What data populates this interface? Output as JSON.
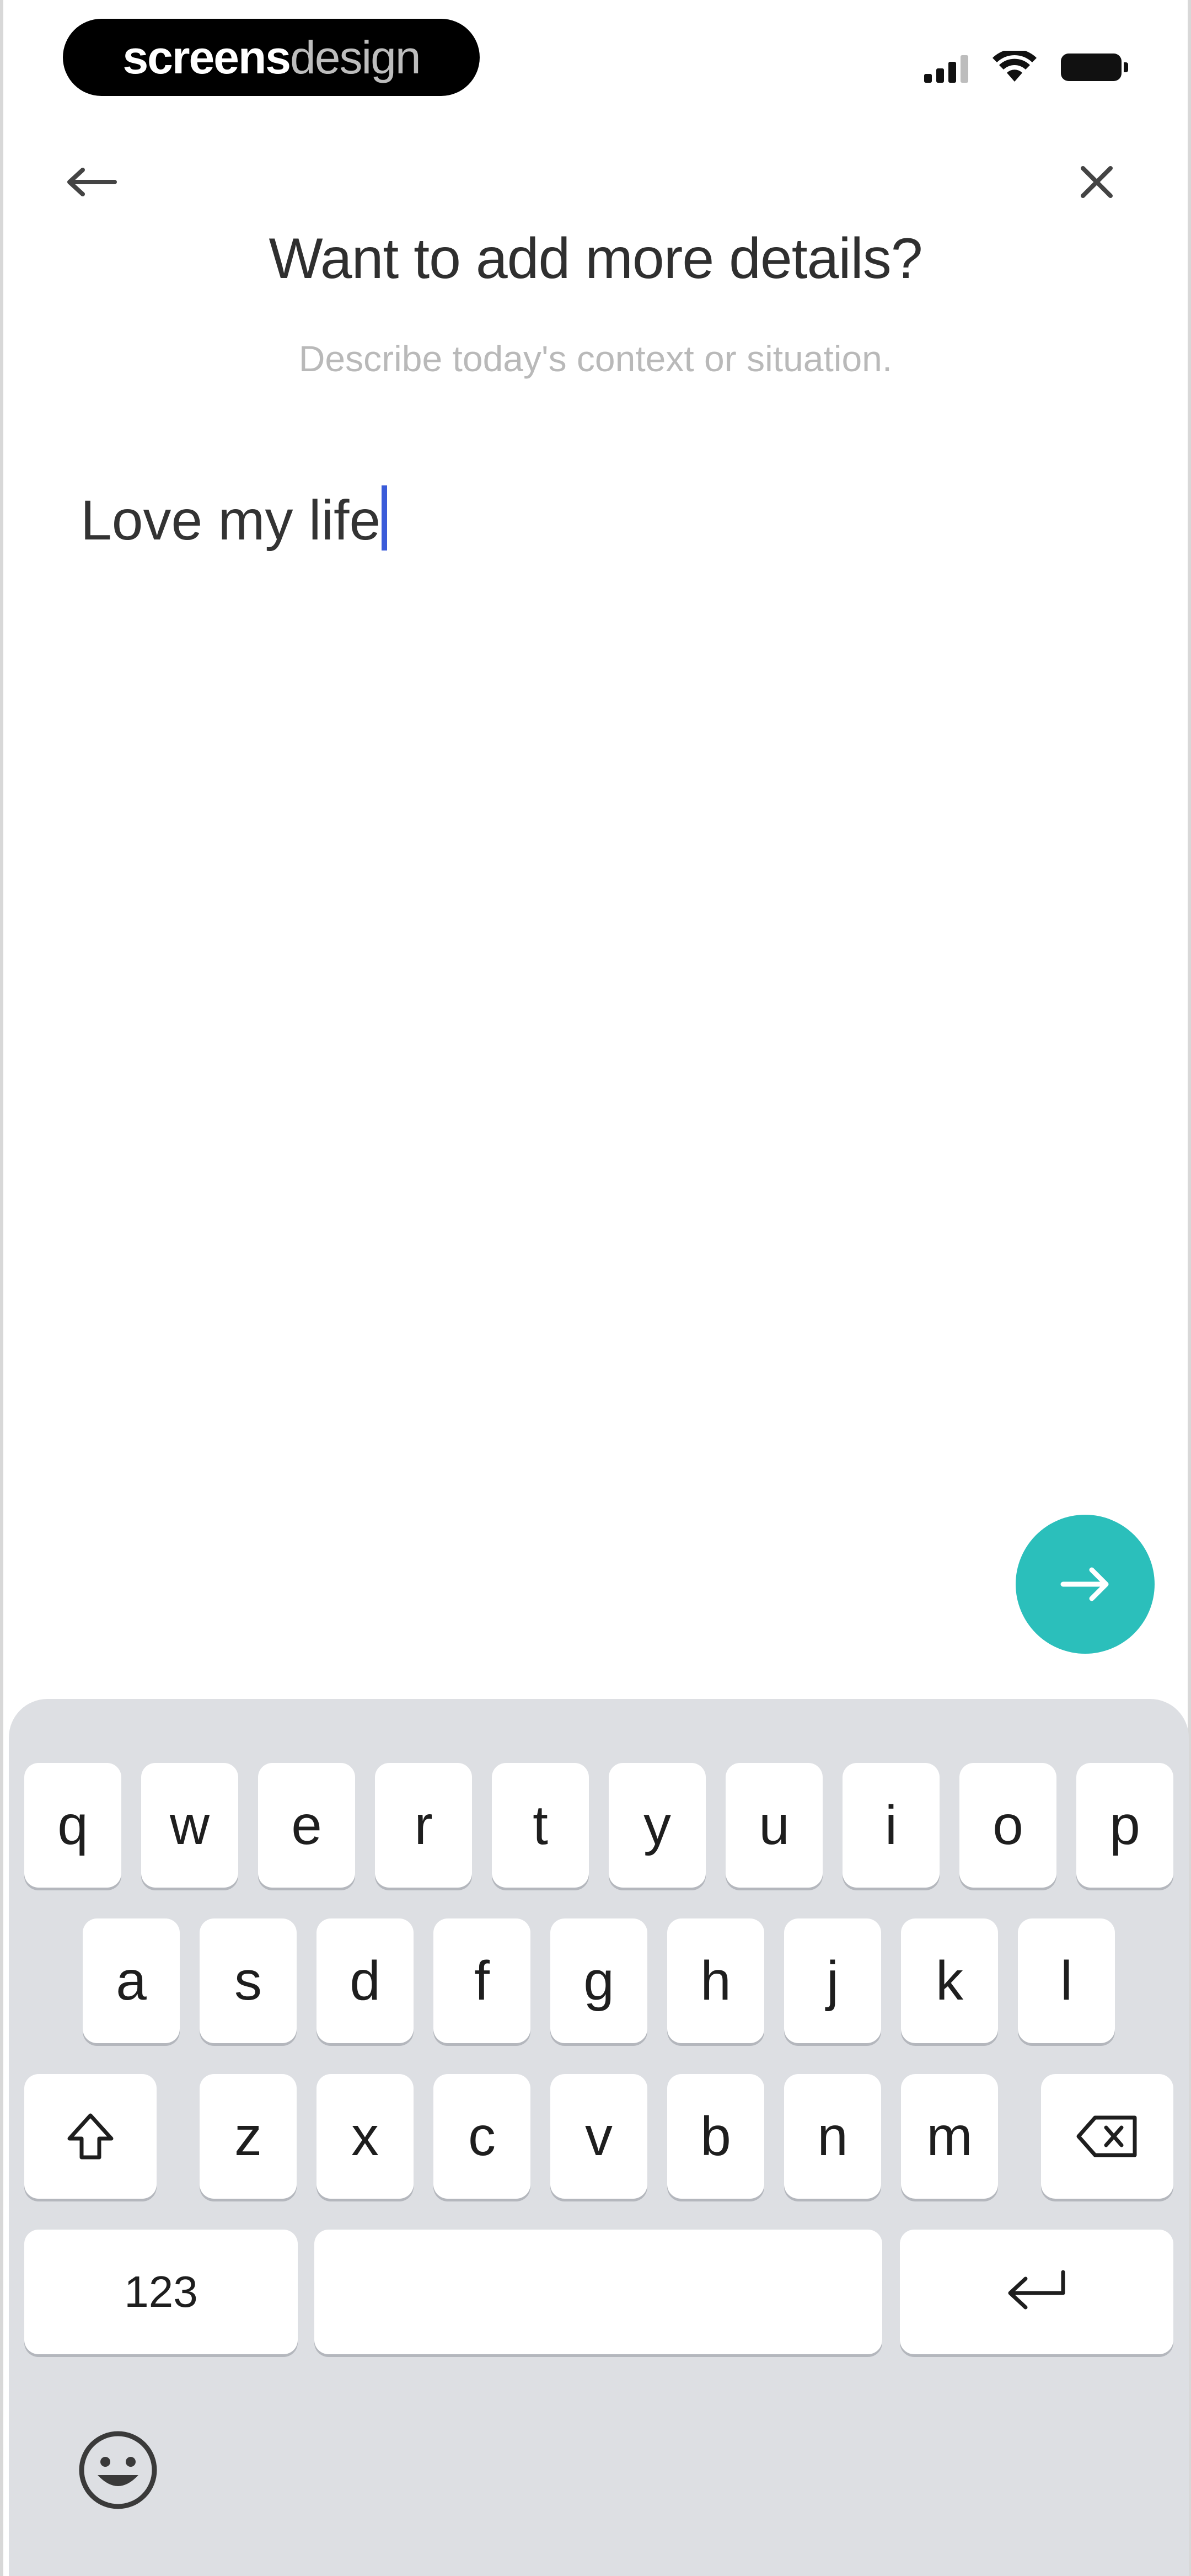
{
  "status_bar": {
    "brand_bold": "screens",
    "brand_thin": "design"
  },
  "header": {
    "back_icon": "arrow-left-icon",
    "close_icon": "close-icon"
  },
  "prompt": {
    "title": "Want to add more details?",
    "subtitle": "Describe today's context or situation."
  },
  "input": {
    "value": "Love my life"
  },
  "next_button": {
    "icon": "arrow-right-icon",
    "color": "#2bbfbb"
  },
  "keyboard": {
    "row1": [
      "q",
      "w",
      "e",
      "r",
      "t",
      "y",
      "u",
      "i",
      "o",
      "p"
    ],
    "row2": [
      "a",
      "s",
      "d",
      "f",
      "g",
      "h",
      "j",
      "k",
      "l"
    ],
    "row3": [
      "z",
      "x",
      "c",
      "v",
      "b",
      "n",
      "m"
    ],
    "numbers_label": "123",
    "shift_icon": "shift-icon",
    "delete_icon": "backspace-icon",
    "return_icon": "return-icon",
    "emoji_icon": "emoji-icon"
  }
}
